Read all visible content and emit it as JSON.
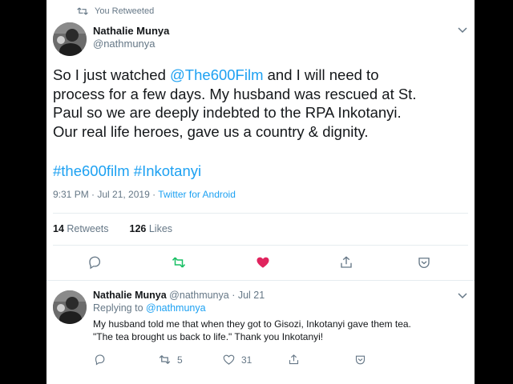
{
  "retweet_notice": {
    "icon": "retweet-icon",
    "text": "You Retweeted"
  },
  "tweet": {
    "author": {
      "name": "Nathalie Munya",
      "handle": "@nathmunya"
    },
    "text_lines": [
      {
        "before": "So I just watched ",
        "mention": "@The600Film",
        "after": " and I will need to"
      },
      {
        "before": "process for a few days. My husband was rescued at St."
      },
      {
        "before": "Paul so we are deeply indebted to the RPA Inkotanyi."
      },
      {
        "before": "Our real life heroes, gave us a country & dignity."
      }
    ],
    "hashtags": "#the600film #Inkotanyi",
    "time": "9:31 PM · Jul 21, 2019 · ",
    "source": "Twitter for Android",
    "stats": {
      "retweets_count": "14",
      "retweets_label": "Retweets",
      "likes_count": "126",
      "likes_label": "Likes"
    },
    "actions": [
      "reply-icon",
      "retweet-icon",
      "like-icon",
      "share-icon",
      "bookmark-icon"
    ],
    "liked": true,
    "retweeted": true
  },
  "reply": {
    "author": {
      "name": "Nathalie Munya",
      "handle": "@nathmunya",
      "date": " · Jul 21"
    },
    "replying_to_label": "Replying to ",
    "replying_to_handle": "@nathmunya",
    "text_lines": [
      "My husband told me that when they got to Gisozi, Inkotanyi gave them tea.",
      "\"The tea brought us back to life.\" Thank you Inkotanyi!"
    ],
    "retweet_count": "5",
    "like_count": "31"
  },
  "colors": {
    "accent": "#1da1f2",
    "retweet_green": "#17bf63",
    "like_red": "#e0245e",
    "secondary_text": "#657786",
    "primary_text": "#14171a"
  }
}
